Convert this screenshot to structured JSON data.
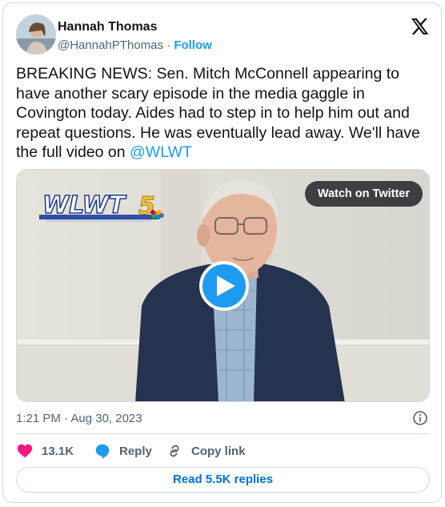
{
  "author": {
    "name": "Hannah Thomas",
    "handle": "@HannahPThomas",
    "separator": "·",
    "follow_label": "Follow"
  },
  "tweet": {
    "text": "BREAKING NEWS: Sen. Mitch McConnell appearing to have another scary episode in the media gaggle in Covington today. Aides had to step in to help him out and repeat questions. He was eventually lead away. We'll have the full video on ",
    "mention": "@WLWT"
  },
  "media": {
    "watch_label": "Watch on Twitter",
    "logo_text": "WLWT",
    "logo_number": "5"
  },
  "meta": {
    "timestamp": "1:21 PM · Aug 30, 2023"
  },
  "actions": {
    "like_count": "13.1K",
    "reply_label": "Reply",
    "copy_label": "Copy link"
  },
  "replies_button": "Read 5.5K replies",
  "colors": {
    "accent": "#1d9bf0",
    "like": "#f91880",
    "text": "#0f1419",
    "muted": "#536471",
    "border": "#cfd9de"
  },
  "icons": [
    "x-logo-icon",
    "play-icon",
    "info-icon",
    "heart-icon",
    "reply-bubble-icon",
    "link-icon",
    "nbc-peacock-icon"
  ]
}
